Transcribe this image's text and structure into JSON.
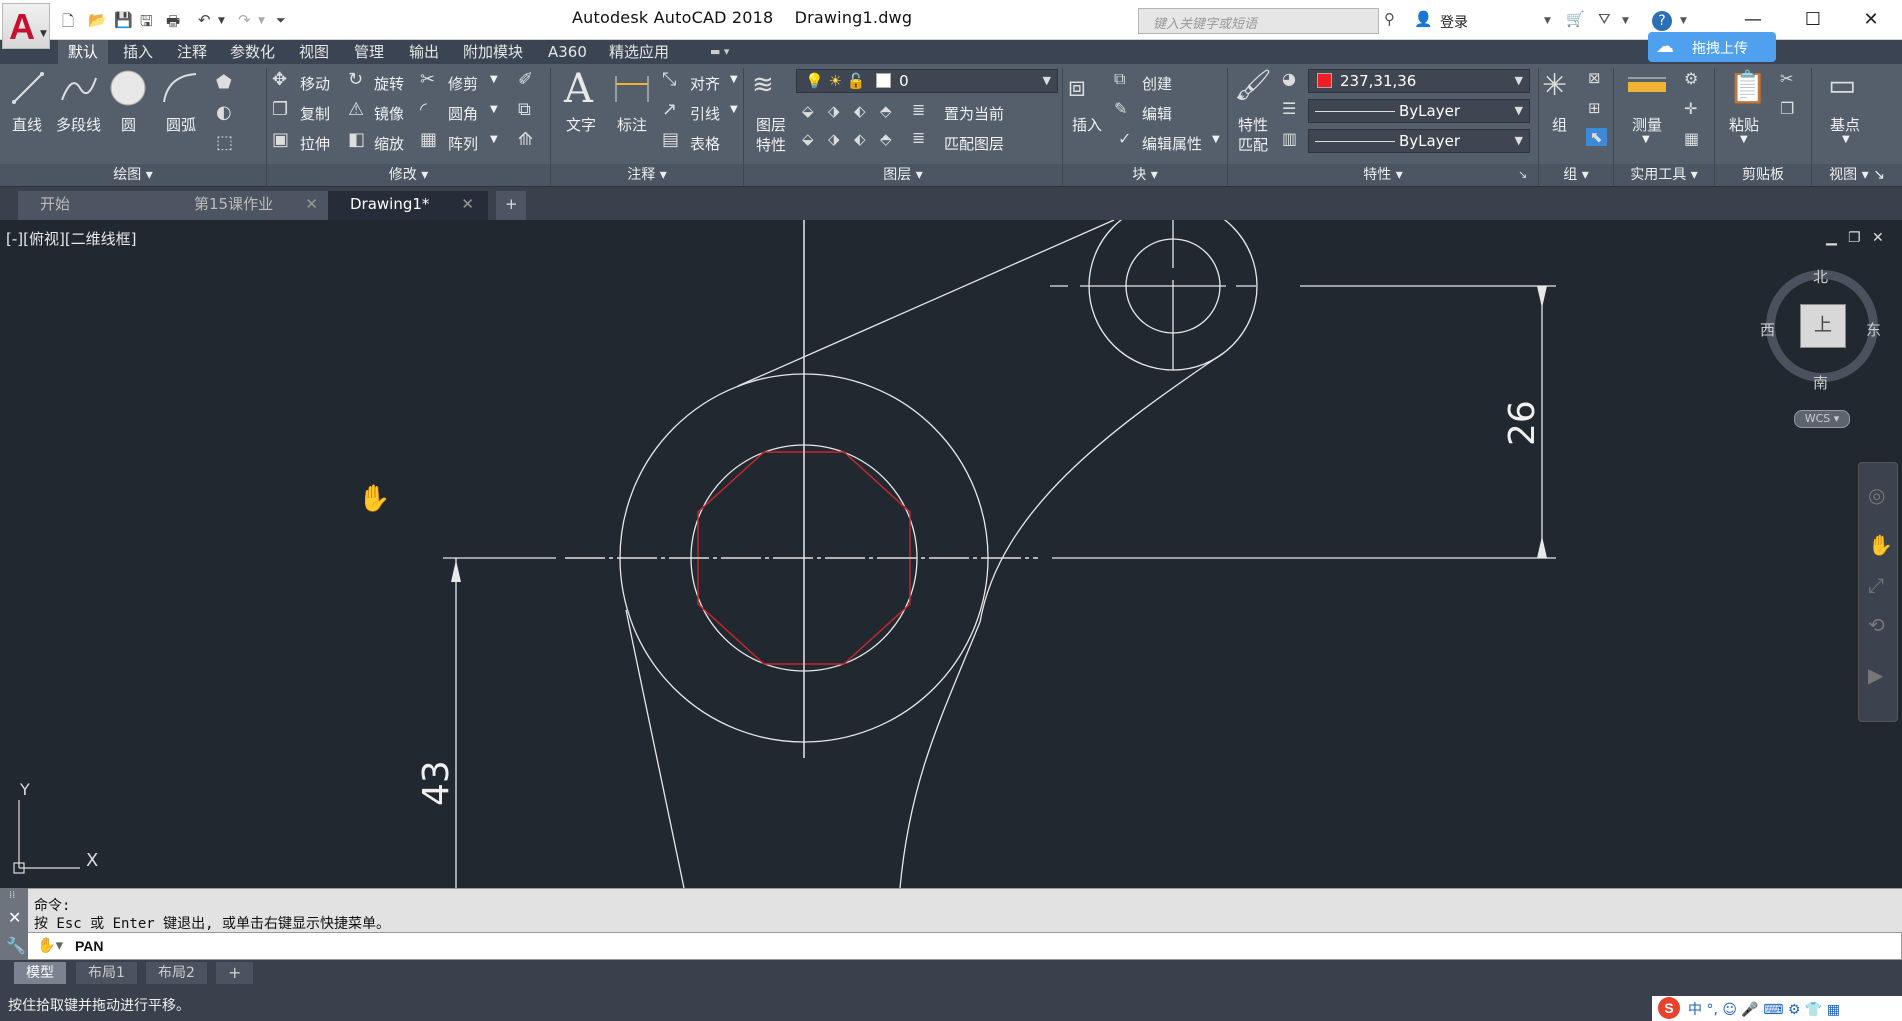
{
  "window": {
    "title": "Autodesk AutoCAD 2018",
    "document": "Drawing1.dwg",
    "search_placeholder": "键入关键字或短语",
    "login": "登录",
    "baidu_upload": "拖拽上传"
  },
  "ribbon_tabs": [
    "默认",
    "插入",
    "注释",
    "参数化",
    "视图",
    "管理",
    "输出",
    "附加模块",
    "A360",
    "精选应用"
  ],
  "panels": {
    "draw": {
      "title": "绘图",
      "line": "直线",
      "polyline": "多段线",
      "circle": "圆",
      "arc": "圆弧"
    },
    "modify": {
      "title": "修改",
      "move": "移动",
      "rotate": "旋转",
      "trim": "修剪",
      "copy": "复制",
      "mirror": "镜像",
      "fillet": "圆角",
      "stretch": "拉伸",
      "scale": "缩放",
      "array": "阵列"
    },
    "annotation": {
      "title": "注释",
      "text": "文字",
      "dimension": "标注",
      "align": "对齐",
      "leader": "引线",
      "table": "表格"
    },
    "layers": {
      "title": "图层",
      "layer_props_1": "图层",
      "layer_props_2": "特性",
      "current_layer": "0",
      "set_current": "置为当前",
      "match_layer": "匹配图层"
    },
    "block": {
      "title": "块",
      "insert": "插入",
      "create": "创建",
      "edit": "编辑",
      "edit_attr": "编辑属性"
    },
    "properties": {
      "title": "特性",
      "match_1": "特性",
      "match_2": "匹配",
      "color": "237,31,36",
      "color_hex": "#ed1f24",
      "linetype": "ByLayer",
      "lineweight": "ByLayer"
    },
    "groups": {
      "title": "组",
      "group": "组"
    },
    "utilities": {
      "title": "实用工具",
      "measure": "测量"
    },
    "clipboard": {
      "title": "剪贴板",
      "paste": "粘贴"
    },
    "view": {
      "title": "视图",
      "base": "基点"
    }
  },
  "doc_tabs": [
    {
      "label": "开始"
    },
    {
      "label": "第15课作业"
    },
    {
      "label": "Drawing1*"
    }
  ],
  "viewport": {
    "label": "[-][俯视][二维线框]",
    "viewcube": {
      "north": "北",
      "south": "南",
      "east": "东",
      "west": "西",
      "top": "上",
      "wcs": "WCS"
    },
    "dims": {
      "vertical_right": "26",
      "vertical_left": "43"
    },
    "ucs": {
      "x": "X",
      "y": "Y"
    }
  },
  "command": {
    "history_1": "命令:",
    "history_2": "按 Esc 或 Enter 键退出, 或单击右键显示快捷菜单。",
    "current": "PAN"
  },
  "layout_tabs": [
    "模型",
    "布局1",
    "布局2"
  ],
  "status_text": "按住拾取键并拖动进行平移。",
  "colors": {
    "canvas": "#212830",
    "ribbon": "#555f6c",
    "hexagon": "#c0282e",
    "accent_blue": "#4fa1ef"
  }
}
